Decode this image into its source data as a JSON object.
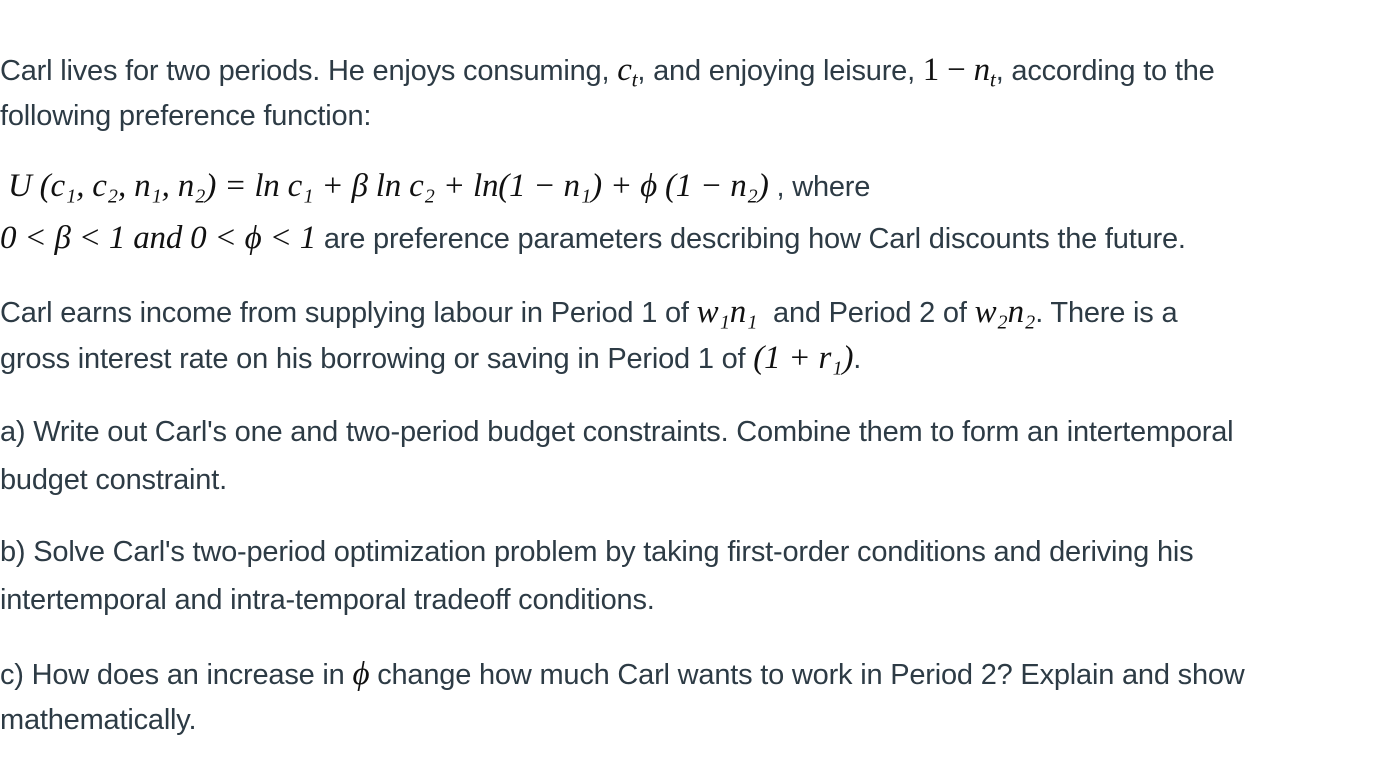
{
  "intro": {
    "line1_a": "Carl lives for two periods. He enjoys consuming, ",
    "ct_var": "c",
    "ct_sub": "t",
    "line1_b": ", and enjoying leisure, ",
    "leisure_expr_1": "1 − ",
    "leisure_var": "n",
    "leisure_sub": "t",
    "line1_c": ", according to the",
    "line2": "following preference function:"
  },
  "utility": {
    "formula": "U (c₁, c₂, n₁, n₂) = ln c₁ + β ln c₂ + ln(1 − n₁) + ϕ (1 − n₂)",
    "after_formula": " , where",
    "params_formula": "0 < β < 1 and 0 < ϕ < 1",
    "params_text": " are preference parameters describing how Carl discounts the future."
  },
  "income": {
    "line1_a": "Carl earns income from supplying labour in Period 1 of ",
    "income1": "w₁n₁",
    "line1_b": "  and Period 2 of ",
    "income2": "w₂n₂",
    "line1_c": ". There is a",
    "line2_a": "gross interest rate on his borrowing or saving in Period 1 of ",
    "rate": "(1 + r₁)",
    "line2_b": "."
  },
  "questions": {
    "a_line1": "a) Write out Carl's one and two-period budget constraints. Combine them to form an intertemporal",
    "a_line2": "budget constraint.",
    "b_line1": "b) Solve Carl's two-period optimization problem by taking first-order conditions and deriving his",
    "b_line2": "intertemporal and intra-temporal tradeoff conditions.",
    "c_line1_a": "c) How does an increase in ",
    "c_phi": "ϕ",
    "c_line1_b": " change how much Carl wants to work in Period 2? Explain and show",
    "c_line2": "mathematically."
  }
}
